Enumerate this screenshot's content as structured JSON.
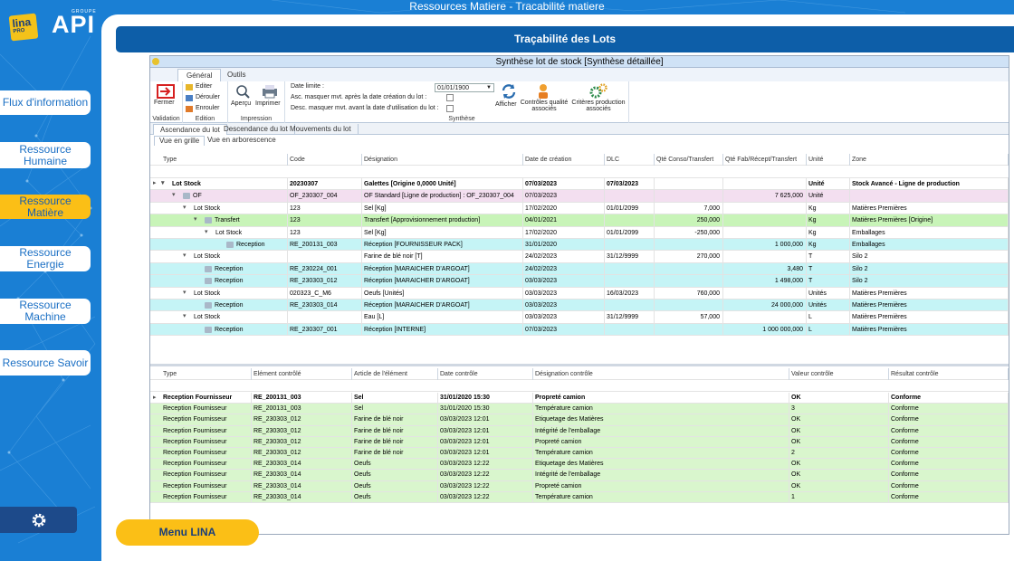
{
  "app": {
    "title": "Ressources Matiere - Tracabilité matiere"
  },
  "logo": {
    "lina": "lina",
    "pro": "PRO",
    "api": "API",
    "groupe": "GROUPE"
  },
  "nav": [
    {
      "label": "Flux d'information",
      "active": false
    },
    {
      "label": "Ressource Humaine",
      "active": false
    },
    {
      "label": "Ressource Matière",
      "active": true
    },
    {
      "label": "Ressource Energie",
      "active": false
    },
    {
      "label": "Ressource Machine",
      "active": false
    },
    {
      "label": "Ressource Savoir",
      "active": false
    }
  ],
  "page": {
    "title": "Traçabilité des Lots"
  },
  "window": {
    "title": "Synthèse lot de stock [Synthèse détaillée]"
  },
  "ribbon": {
    "tabs": [
      "Général",
      "Outils"
    ],
    "validation": {
      "fermer": "Fermer",
      "label": "Validation"
    },
    "edition": {
      "editer": "Editer",
      "derouler": "Dérouler",
      "enrouler": "Enrouler",
      "label": "Edition"
    },
    "impression": {
      "apercu": "Aperçu",
      "imprimer": "Imprimer",
      "label": "Impression"
    },
    "synthese": {
      "date_limite_label": "Date limite :",
      "date_limite_value": "01/01/1900",
      "asc_label": "Asc. masquer mvt. après la date création du lot :",
      "desc_label": "Desc. masquer mvt. avant la date d'utilisation du lot :",
      "afficher": "Afficher",
      "controles": "Contrôles qualité associés",
      "criteres": "Critères production associés",
      "label": "Synthèse"
    }
  },
  "subtabs": [
    "Ascendance du lot",
    "Descendance du lot",
    "Mouvements du lot"
  ],
  "viewtabs": [
    "Vue en grille",
    "Vue en arborescence"
  ],
  "top_grid": {
    "headers": [
      "Type",
      "Code",
      "Désignation",
      "Date de création",
      "DLC",
      "Qté Conso/Transfert",
      "Qté Fab/Récept/Transfert",
      "Unité",
      "Zone"
    ],
    "rows": [
      {
        "type": "Lot Stock",
        "code": "20230307",
        "designation": "Galettes [Origine 0,0000 Unité]",
        "date": "07/03/2023",
        "dlc": "07/03/2023",
        "conso": "",
        "fab": "",
        "unite": "Unité",
        "zone": "Stock Avancé - Ligne de production",
        "bold": true,
        "style": "",
        "level": 0,
        "toggle": "▾",
        "arrow": "▸",
        "icon": false
      },
      {
        "type": "OF",
        "code": "OF_230307_004",
        "designation": "OF Standard [Ligne de production] : OF_230307_004",
        "date": "07/03/2023",
        "dlc": "",
        "conso": "",
        "fab": "7 625,000",
        "unite": "Unité",
        "zone": "",
        "bold": false,
        "style": "pink",
        "level": 1,
        "toggle": "▾",
        "arrow": "",
        "icon": true
      },
      {
        "type": "Lot Stock",
        "code": "123",
        "designation": "Sel [Kg]",
        "date": "17/02/2020",
        "dlc": "01/01/2099",
        "conso": "7,000",
        "fab": "",
        "unite": "Kg",
        "zone": "Matières Premières",
        "bold": false,
        "style": "",
        "level": 2,
        "toggle": "▾",
        "arrow": "",
        "icon": false
      },
      {
        "type": "Transfert",
        "code": "123",
        "designation": "Transfert [Approvisionnement production]",
        "date": "04/01/2021",
        "dlc": "",
        "conso": "250,000",
        "fab": "",
        "unite": "Kg",
        "zone": "Matières Premières [Origine]",
        "bold": false,
        "style": "green",
        "level": 3,
        "toggle": "▾",
        "arrow": "",
        "icon": true
      },
      {
        "type": "Lot Stock",
        "code": "123",
        "designation": "Sel [Kg]",
        "date": "17/02/2020",
        "dlc": "01/01/2099",
        "conso": "-250,000",
        "fab": "",
        "unite": "Kg",
        "zone": "Emballages",
        "bold": false,
        "style": "",
        "level": 4,
        "toggle": "▾",
        "arrow": "",
        "icon": false
      },
      {
        "type": "Reception",
        "code": "RE_200131_003",
        "designation": "Réception [FOURNISSEUR PACK]",
        "date": "31/01/2020",
        "dlc": "",
        "conso": "",
        "fab": "1 000,000",
        "unite": "Kg",
        "zone": "Emballages",
        "bold": false,
        "style": "cyan",
        "level": 5,
        "toggle": "",
        "arrow": "",
        "icon": true
      },
      {
        "type": "Lot Stock",
        "code": "",
        "designation": "Farine de blé noir [T]",
        "date": "24/02/2023",
        "dlc": "31/12/9999",
        "conso": "270,000",
        "fab": "",
        "unite": "T",
        "zone": "Silo 2",
        "bold": false,
        "style": "",
        "level": 2,
        "toggle": "▾",
        "arrow": "",
        "icon": false
      },
      {
        "type": "Reception",
        "code": "RE_230224_001",
        "designation": "Réception [MARAICHER D'ARGOAT]",
        "date": "24/02/2023",
        "dlc": "",
        "conso": "",
        "fab": "3,480",
        "unite": "T",
        "zone": "Silo 2",
        "bold": false,
        "style": "cyan",
        "level": 3,
        "toggle": "",
        "arrow": "",
        "icon": true
      },
      {
        "type": "Reception",
        "code": "RE_230303_012",
        "designation": "Réception [MARAICHER D'ARGOAT]",
        "date": "03/03/2023",
        "dlc": "",
        "conso": "",
        "fab": "1 498,000",
        "unite": "T",
        "zone": "Silo 2",
        "bold": false,
        "style": "cyan",
        "level": 3,
        "toggle": "",
        "arrow": "",
        "icon": true
      },
      {
        "type": "Lot Stock",
        "code": "020323_C_M6",
        "designation": "Oeufs [Unités]",
        "date": "03/03/2023",
        "dlc": "16/03/2023",
        "conso": "760,000",
        "fab": "",
        "unite": "Unités",
        "zone": "Matières Premières",
        "bold": false,
        "style": "",
        "level": 2,
        "toggle": "▾",
        "arrow": "",
        "icon": false
      },
      {
        "type": "Reception",
        "code": "RE_230303_014",
        "designation": "Réception [MARAICHER D'ARGOAT]",
        "date": "03/03/2023",
        "dlc": "",
        "conso": "",
        "fab": "24 000,000",
        "unite": "Unités",
        "zone": "Matières Premières",
        "bold": false,
        "style": "cyan",
        "level": 3,
        "toggle": "",
        "arrow": "",
        "icon": true
      },
      {
        "type": "Lot Stock",
        "code": "",
        "designation": "Eau [L]",
        "date": "03/03/2023",
        "dlc": "31/12/9999",
        "conso": "57,000",
        "fab": "",
        "unite": "L",
        "zone": "Matières Premières",
        "bold": false,
        "style": "",
        "level": 2,
        "toggle": "▾",
        "arrow": "",
        "icon": false
      },
      {
        "type": "Reception",
        "code": "RE_230307_001",
        "designation": "Réception [INTERNE]",
        "date": "07/03/2023",
        "dlc": "",
        "conso": "",
        "fab": "1 000 000,000",
        "unite": "L",
        "zone": "Matières Premières",
        "bold": false,
        "style": "cyan",
        "level": 3,
        "toggle": "",
        "arrow": "",
        "icon": true
      }
    ]
  },
  "bottom_grid": {
    "headers": [
      "Type",
      "Elément contrôlé",
      "Article de l'élément",
      "Date contrôle",
      "Désignation contrôle",
      "Valeur contrôle",
      "Résultat contrôle"
    ],
    "rows": [
      [
        "Reception Fournisseur",
        "RE_200131_003",
        "Sel",
        "31/01/2020 15:30",
        "Propreté camion",
        "OK",
        "Conforme"
      ],
      [
        "Reception Fournisseur",
        "RE_200131_003",
        "Sel",
        "31/01/2020 15:30",
        "Température camion",
        "3",
        "Conforme"
      ],
      [
        "Reception Fournisseur",
        "RE_230303_012",
        "Farine de blé noir",
        "03/03/2023 12:01",
        "Etiquetage des Matières",
        "OK",
        "Conforme"
      ],
      [
        "Reception Fournisseur",
        "RE_230303_012",
        "Farine de blé noir",
        "03/03/2023 12:01",
        "Intégrité de l'emballage",
        "OK",
        "Conforme"
      ],
      [
        "Reception Fournisseur",
        "RE_230303_012",
        "Farine de blé noir",
        "03/03/2023 12:01",
        "Propreté camion",
        "OK",
        "Conforme"
      ],
      [
        "Reception Fournisseur",
        "RE_230303_012",
        "Farine de blé noir",
        "03/03/2023 12:01",
        "Température camion",
        "2",
        "Conforme"
      ],
      [
        "Reception Fournisseur",
        "RE_230303_014",
        "Oeufs",
        "03/03/2023 12:22",
        "Etiquetage des Matières",
        "OK",
        "Conforme"
      ],
      [
        "Reception Fournisseur",
        "RE_230303_014",
        "Oeufs",
        "03/03/2023 12:22",
        "Intégrité de l'emballage",
        "OK",
        "Conforme"
      ],
      [
        "Reception Fournisseur",
        "RE_230303_014",
        "Oeufs",
        "03/03/2023 12:22",
        "Propreté camion",
        "OK",
        "Conforme"
      ],
      [
        "Reception Fournisseur",
        "RE_230303_014",
        "Oeufs",
        "03/03/2023 12:22",
        "Température camion",
        "1",
        "Conforme"
      ]
    ]
  },
  "menu": {
    "label": "Menu LINA"
  },
  "icons": {
    "settings": "gear-icon",
    "fermer": "exit-icon",
    "afficher": "refresh-icon"
  }
}
